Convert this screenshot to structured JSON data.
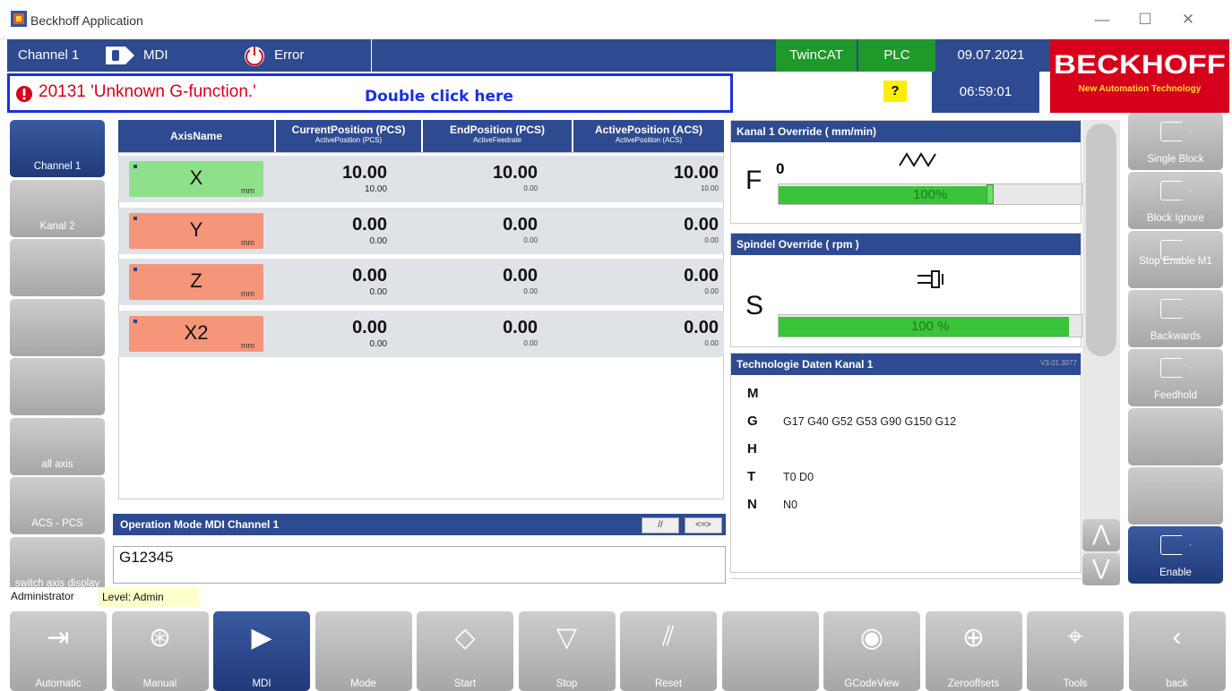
{
  "window": {
    "title": "Beckhoff Application",
    "min": "—",
    "max": "☐",
    "close": "✕"
  },
  "status": {
    "channel": "Channel 1",
    "mode": "MDI",
    "state": "Error",
    "twincat": "TwinCAT",
    "plc": "PLC",
    "date": "09.07.2021",
    "time": "06:59:01",
    "help": "?"
  },
  "message": {
    "text": "20131 'Unknown G-function.'",
    "hint": "Double click here"
  },
  "brand": {
    "name": "BECKHOFF",
    "tagline": "New Automation Technology"
  },
  "colors": {
    "header": "#2e4a90",
    "accent_red": "#d6001c",
    "green": "#39c43a"
  },
  "left_buttons": [
    "Channel 1",
    "Kanal 2",
    "",
    "",
    "",
    "all axis",
    "ACS - PCS",
    "switch axis display"
  ],
  "right_buttons": [
    {
      "label": "Single Block",
      "icon": "single-block-icon"
    },
    {
      "label": "Block Ignore",
      "icon": "block-ignore-icon"
    },
    {
      "label": "Stop Enable M1",
      "icon": "stop-enable-icon"
    },
    {
      "label": "Backwards",
      "icon": "backwards-icon"
    },
    {
      "label": "Feedhold",
      "icon": "feedhold-icon"
    },
    {
      "label": "",
      "icon": ""
    },
    {
      "label": "",
      "icon": ""
    },
    {
      "label": "Enable",
      "icon": "enable-icon"
    }
  ],
  "axis_table": {
    "headers": [
      {
        "main": "AxisName",
        "sub": ""
      },
      {
        "main": "CurrentPosition (PCS)",
        "sub": "ActivePosition (PCS)"
      },
      {
        "main": "EndPosition (PCS)",
        "sub": "ActiveFeedrate"
      },
      {
        "main": "ActivePosition (ACS)",
        "sub": "ActivePosition (ACS)"
      }
    ],
    "rows": [
      {
        "name": "X",
        "unit": "mm",
        "cur": "10.00",
        "cur_sub": "10.00",
        "end": "10.00",
        "end_sub": "0.00",
        "act": "10.00",
        "act_sub": "10.00",
        "color": "#8fe08a"
      },
      {
        "name": "Y",
        "unit": "mm",
        "cur": "0.00",
        "cur_sub": "0.00",
        "end": "0.00",
        "end_sub": "0.00",
        "act": "0.00",
        "act_sub": "0.00",
        "color": "#f5957a"
      },
      {
        "name": "Z",
        "unit": "mm",
        "cur": "0.00",
        "cur_sub": "0.00",
        "end": "0.00",
        "end_sub": "0.00",
        "act": "0.00",
        "act_sub": "0.00",
        "color": "#f5957a"
      },
      {
        "name": "X2",
        "unit": "mm",
        "cur": "0.00",
        "cur_sub": "0.00",
        "end": "0.00",
        "end_sub": "0.00",
        "act": "0.00",
        "act_sub": "0.00",
        "color": "#f5957a"
      }
    ]
  },
  "mdi": {
    "title": "Operation Mode MDI Channel 1",
    "btn1": "//",
    "btn2": "<=>",
    "input": "G12345"
  },
  "override": {
    "feed_title": "Kanal 1 Override  ( mm/min)",
    "feed_letter": "F",
    "feed_value": "0",
    "feed_percent": "100%",
    "feed_level": 1.0,
    "spindle_title": "Spindel Override  ( rpm    )",
    "spindle_letter": "S",
    "spindle_percent": "100 %",
    "spindle_level": 1.0
  },
  "tech": {
    "title": "Technologie Daten Kanal 1",
    "version": "V3.01.3077",
    "rows": [
      {
        "k": "M",
        "v": ""
      },
      {
        "k": "G",
        "v": "G17 G40 G52 G53 G90 G150 G12"
      },
      {
        "k": "H",
        "v": ""
      },
      {
        "k": "T",
        "v": "T0  D0"
      },
      {
        "k": "N",
        "v": "N0"
      }
    ]
  },
  "user": {
    "name": "Administrator",
    "level": "Level: Admin"
  },
  "bottom_buttons": [
    {
      "label": "Automatic",
      "icon": "automatic-icon"
    },
    {
      "label": "Manual",
      "icon": "manual-icon"
    },
    {
      "label": "MDI",
      "icon": "mdi-icon"
    },
    {
      "label": "Mode",
      "icon": ""
    },
    {
      "label": "Start",
      "icon": "start-icon"
    },
    {
      "label": "Stop",
      "icon": "stop-icon"
    },
    {
      "label": "Reset",
      "icon": "reset-icon"
    },
    {
      "label": "",
      "icon": ""
    },
    {
      "label": "GCodeView",
      "icon": "gcodeview-icon"
    },
    {
      "label": "Zerooffsets",
      "icon": "zerooffsets-icon"
    },
    {
      "label": "Tools",
      "icon": "tools-icon"
    },
    {
      "label": "back",
      "icon": "back-icon"
    }
  ]
}
